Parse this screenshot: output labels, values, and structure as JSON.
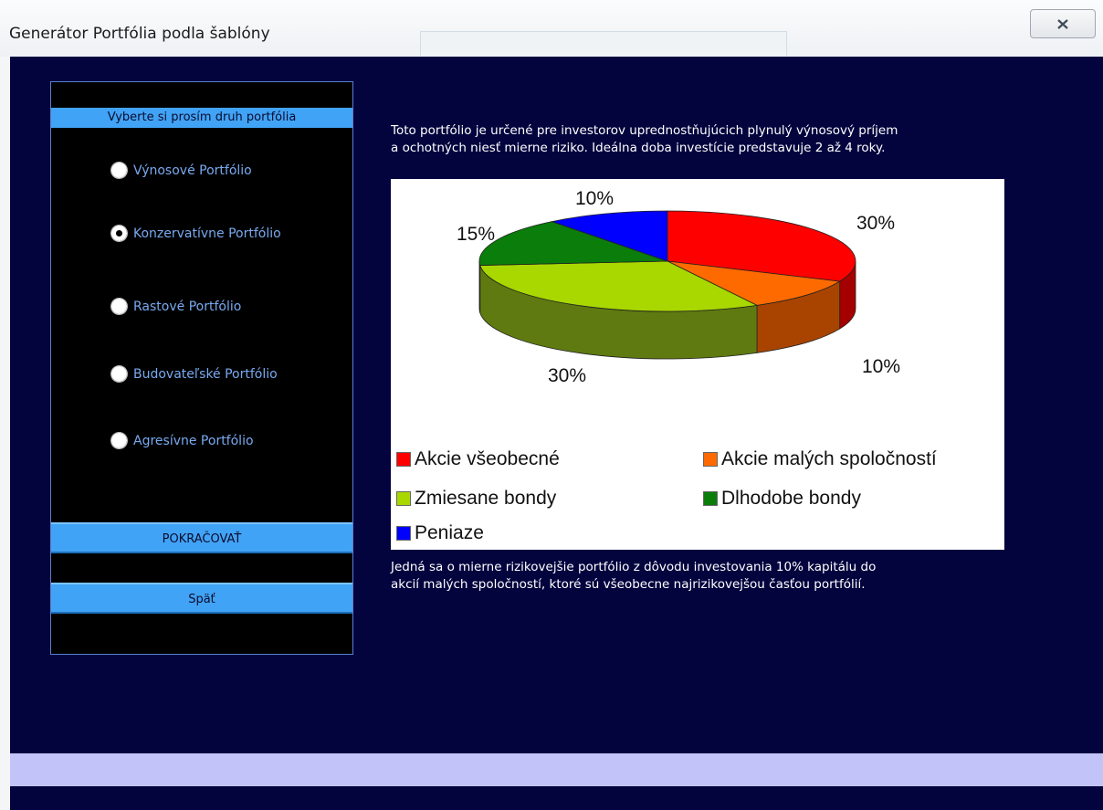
{
  "window": {
    "title": "Generátor Portfólia podla šablóny",
    "close_icon": "close-icon"
  },
  "panel": {
    "header": "Vyberte si prosím druh portfólia",
    "options": [
      {
        "label": "Výnosové Portfólio",
        "checked": false
      },
      {
        "label": "Konzervatívne Portfólio",
        "checked": true
      },
      {
        "label": "Rastové Portfólio",
        "checked": false
      },
      {
        "label": "Budovateľské Portfólio",
        "checked": false
      },
      {
        "label": "Agresívne Portfólio",
        "checked": false
      }
    ],
    "continue_label": "POKRAČOVAŤ",
    "back_label": "Späť"
  },
  "description": {
    "top_line1": "Toto portfólio je určené pre investorov uprednostňujúcich plynulý výnosový príjem",
    "top_line2": "a ochotných niesť mierne riziko. Ideálna doba investície predstavuje 2 až 4 roky.",
    "bottom_line1": "Jedná sa o mierne rizikovejšie portfólio z dôvodu investovania 10% kapitálu do",
    "bottom_line2": "akcií malých spoločností, ktoré sú všeobecne najrizikovejšou časťou portfólií."
  },
  "colors": {
    "background": "#03033e",
    "accent": "#41a3f5",
    "option_text": "#78aaf0",
    "status_bar": "#c2c3f8"
  },
  "chart_data": {
    "type": "pie",
    "style": "3d",
    "legend_position": "bottom",
    "slices": [
      {
        "name": "Akcie všeobecné",
        "value": 30,
        "label": "30%",
        "color": "#ff0000",
        "side": "#a50000"
      },
      {
        "name": "Akcie malých spoločností",
        "value": 10,
        "label": "10%",
        "color": "#ff6a00",
        "side": "#a84400"
      },
      {
        "name": "Zmiesane bondy",
        "value": 30,
        "label": "30%",
        "color": "#a8d800",
        "side": "#5f7a10"
      },
      {
        "name": "Dlhodobe bondy",
        "value": 15,
        "label": "15%",
        "color": "#0a7d0a",
        "side": "#064d06"
      },
      {
        "name": "Peniaze",
        "value": 10,
        "label": "10%",
        "color": "#0000ff",
        "side": "#00009a"
      }
    ],
    "legend_order": [
      "Akcie všeobecné",
      "Akcie malých spoločností",
      "Zmiesane bondy",
      "Dlhodobe bondy",
      "Peniaze"
    ]
  }
}
